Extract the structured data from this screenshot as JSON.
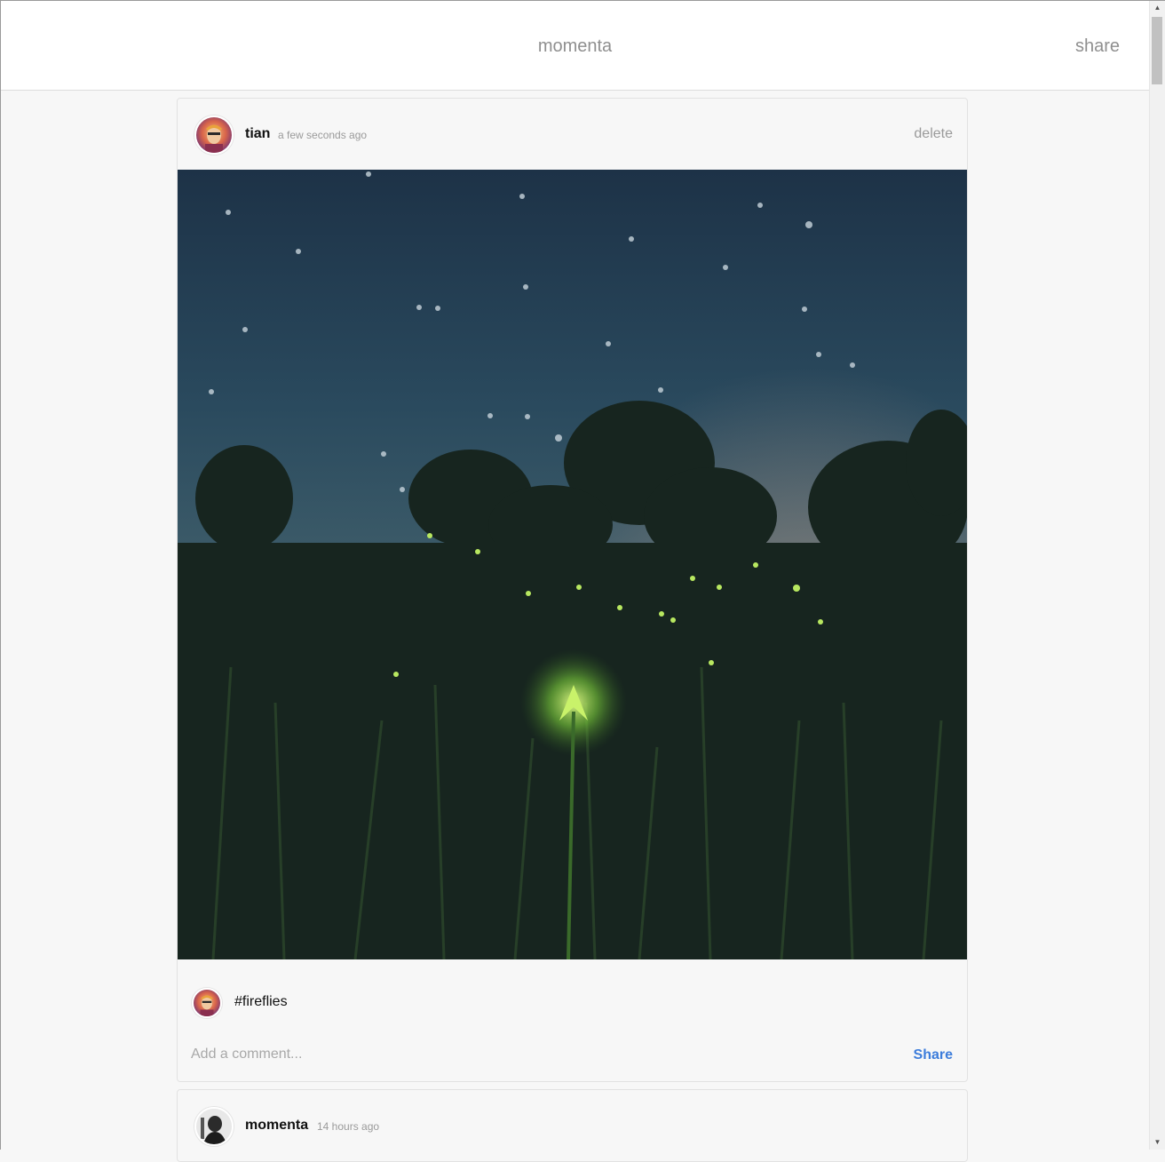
{
  "header": {
    "brand": "momenta",
    "share_label": "share"
  },
  "posts": [
    {
      "username": "tian",
      "timestamp": "a few seconds ago",
      "delete_label": "delete",
      "caption": "#fireflies",
      "comment_placeholder": "Add a comment...",
      "share_label": "Share"
    },
    {
      "username": "momenta",
      "timestamp": "14 hours ago"
    }
  ],
  "colors": {
    "accent": "#3d7ddb",
    "muted": "#8f8f8f",
    "background": "#f7f7f7"
  }
}
